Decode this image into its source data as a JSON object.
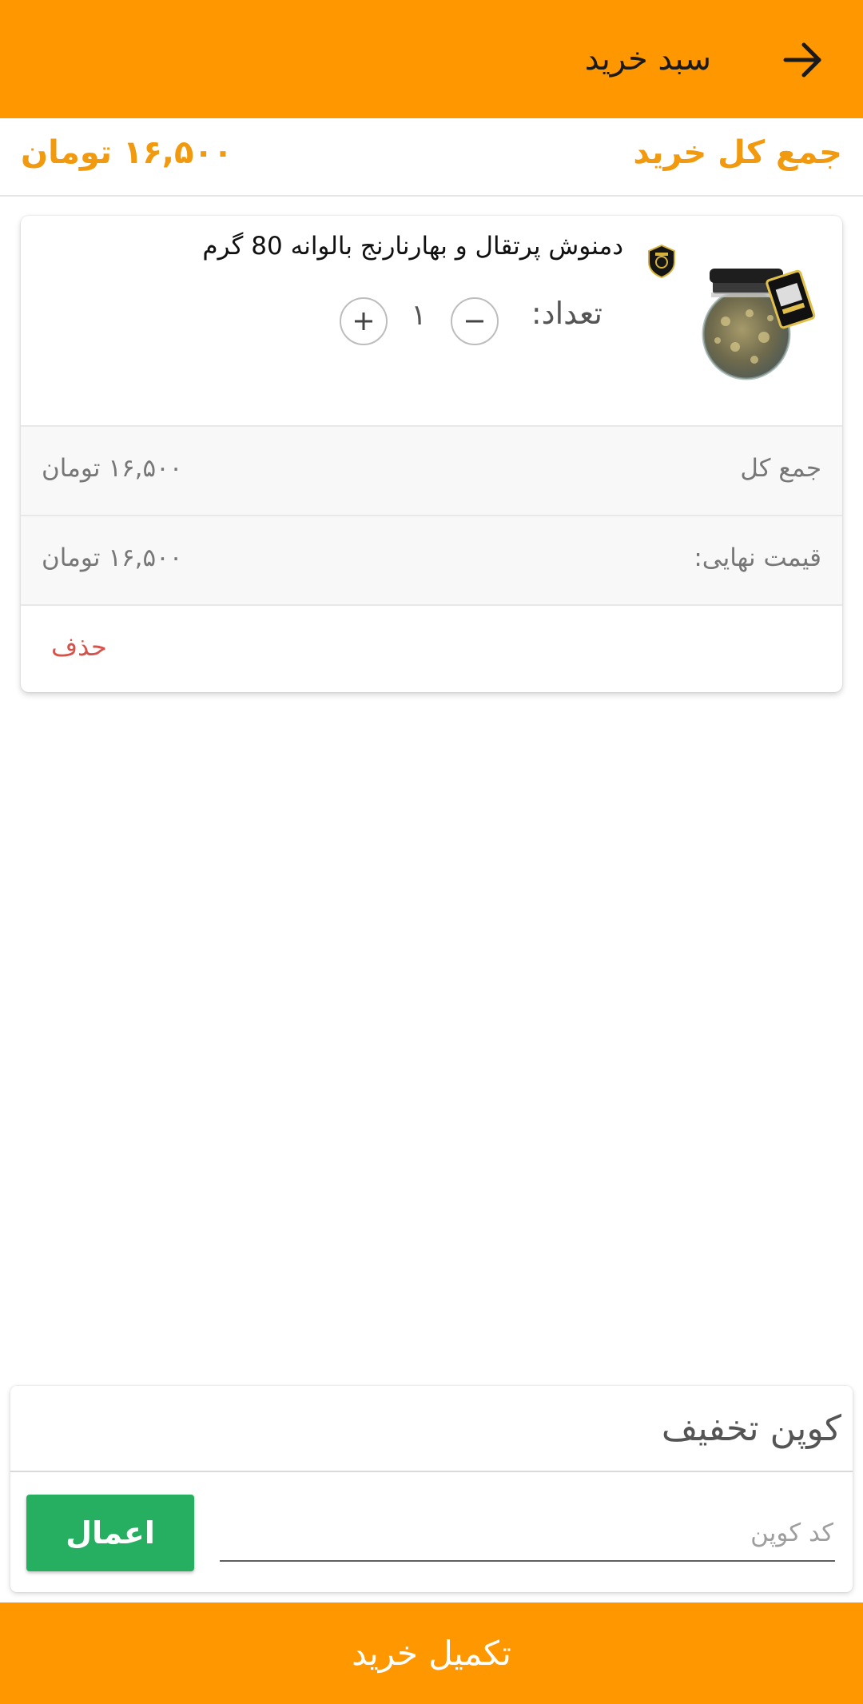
{
  "app_bar": {
    "title": "سبد خرید",
    "back_icon": "arrow-right-icon",
    "color": "#FF9700"
  },
  "cart_total": {
    "label": "جمع کل خرید",
    "value": "۱۶,۵۰۰ تومان",
    "color": "#F19A0F"
  },
  "cart_items": [
    {
      "name": "دمنوش پرتقال و بهارنارنج بالوانه 80 گرم",
      "image_icon": "honey-jar-product-image",
      "brand_icon": "brand-logo-icon",
      "quantity_label": "تعداد:",
      "quantity": "۱",
      "minus_icon": "minus-icon",
      "plus_icon": "plus-icon",
      "subtotal_label": "جمع کل",
      "subtotal_value": "۱۶,۵۰۰ تومان",
      "final_price_label": "قیمت نهایی:",
      "final_price_value": "۱۶,۵۰۰ تومان",
      "delete_label": "حذف",
      "delete_color": "#D5534B"
    }
  ],
  "coupon": {
    "title": "کوپن تخفیف",
    "placeholder": "کد کوپن",
    "apply_label": "اعمال",
    "apply_color": "#26AE61"
  },
  "checkout": {
    "label": "تکمیل خرید",
    "color": "#FF9700"
  }
}
